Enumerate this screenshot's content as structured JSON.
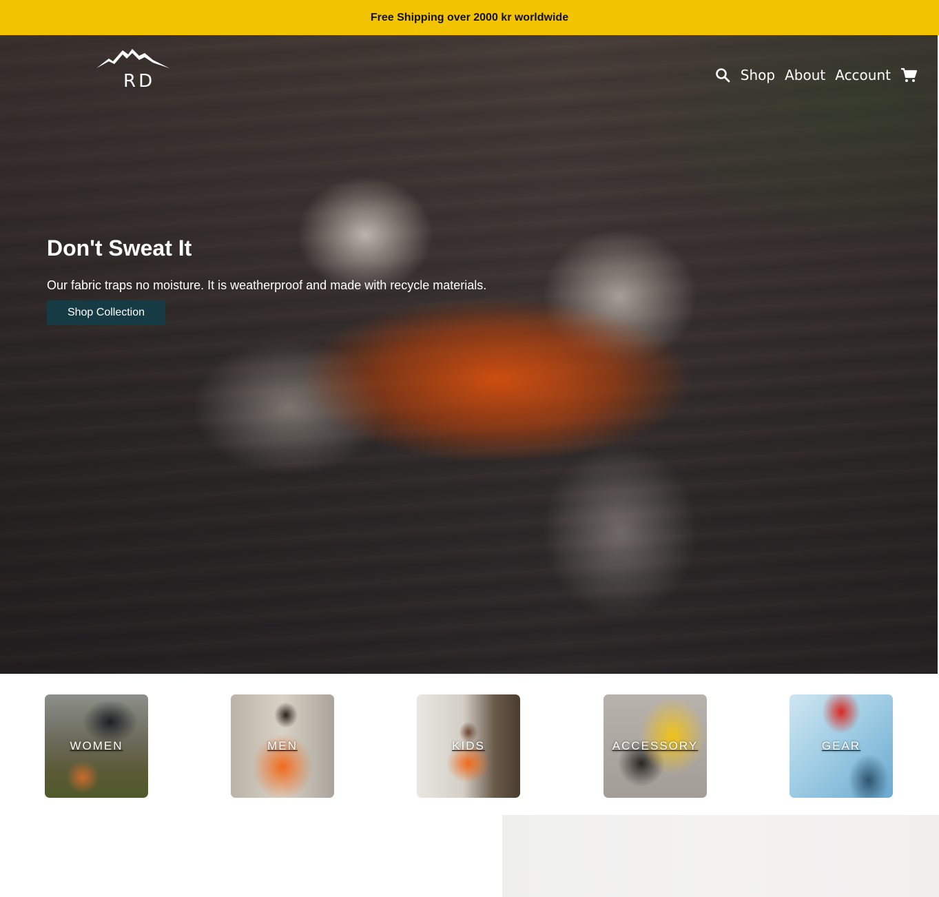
{
  "announcement": {
    "text": "Free Shipping over 2000 kr worldwide"
  },
  "brand": {
    "logo_text": "RD",
    "logo_icon": "mountain-icon"
  },
  "nav": {
    "search_icon": "search-icon",
    "items": [
      {
        "label": "Shop"
      },
      {
        "label": "About"
      },
      {
        "label": "Account"
      }
    ],
    "cart_icon": "cart-icon"
  },
  "hero": {
    "title": "Don't Sweat It",
    "subtitle": "Our fabric traps no moisture. It is weatherproof and made with recycle materials.",
    "button_label": "Shop Collection",
    "button_color": "#173b45"
  },
  "categories": [
    {
      "label": "WOMEN"
    },
    {
      "label": "MEN"
    },
    {
      "label": "KIDS"
    },
    {
      "label": "ACCESSORY"
    },
    {
      "label": "GEAR"
    }
  ],
  "colors": {
    "announcement_bg": "#f2c300",
    "accent": "#173b45"
  }
}
